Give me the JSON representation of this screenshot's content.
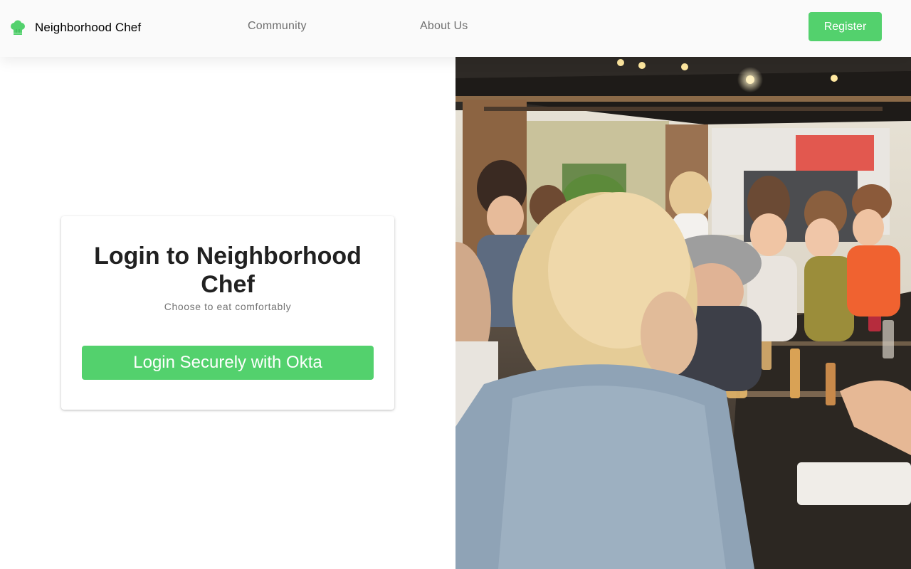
{
  "brand": {
    "name": "Neighborhood Chef",
    "icon": "chef-hat-icon",
    "accent_color": "#53d16d"
  },
  "nav": {
    "links": [
      "Community",
      "About Us"
    ],
    "register_label": "Register"
  },
  "login": {
    "title": "Login to Neighborhood Chef",
    "subtitle": "Choose to eat comfortably",
    "button_label": "Login Securely with Okta"
  }
}
